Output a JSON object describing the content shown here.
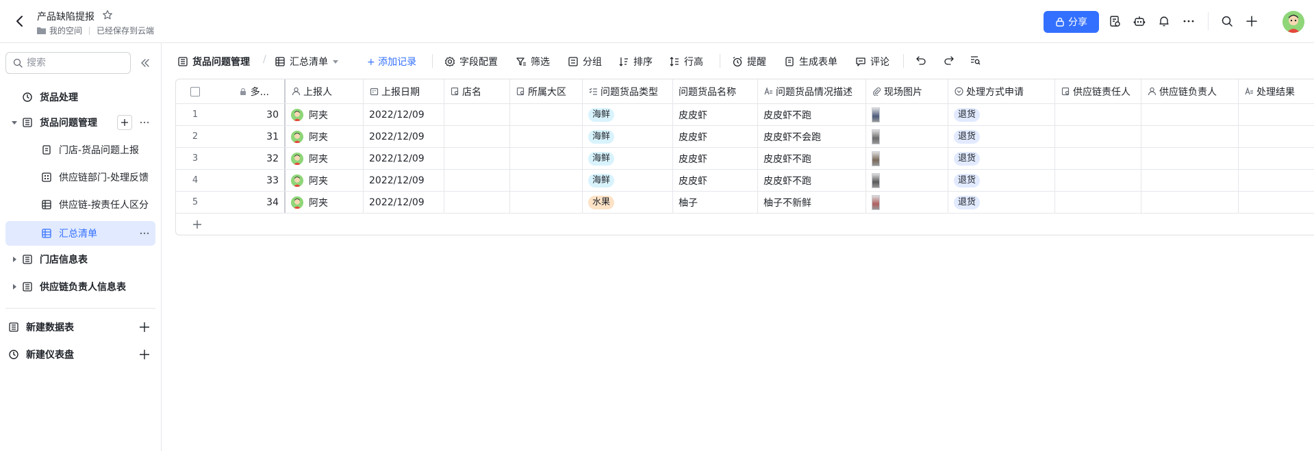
{
  "header": {
    "doc_title": "产品缺陷提报",
    "breadcrumb_space": "我的空间",
    "save_status": "已经保存到云端",
    "share_label": "分享"
  },
  "sidebar": {
    "search_placeholder": "搜索",
    "items": [
      {
        "label": "货品处理"
      },
      {
        "label": "货品问题管理"
      },
      {
        "label": "门店-货品问题上报"
      },
      {
        "label": "供应链部门-处理反馈"
      },
      {
        "label": "供应链-按责任人区分"
      },
      {
        "label": "汇总清单"
      },
      {
        "label": "门店信息表"
      },
      {
        "label": "供应链负责人信息表"
      }
    ],
    "new_table": "新建数据表",
    "new_dashboard": "新建仪表盘"
  },
  "toolbar": {
    "table_name": "货品问题管理",
    "view_name": "汇总清单",
    "add_record": "+ 添加记录",
    "field_config": "字段配置",
    "filter": "筛选",
    "group": "分组",
    "sort": "排序",
    "row_height": "行高",
    "reminder": "提醒",
    "form": "生成表单",
    "comment": "评论"
  },
  "table": {
    "columns": [
      "多...",
      "上报人",
      "上报日期",
      "店名",
      "所属大区",
      "问题货品类型",
      "问题货品名称",
      "问题货品情况描述",
      "现场图片",
      "处理方式申请",
      "供应链责任人",
      "供应链负责人",
      "处理结果"
    ],
    "rows": [
      {
        "idx": "1",
        "no": "30",
        "reporter": "阿夹",
        "date": "2022/12/09",
        "type": "海鲜",
        "name": "皮皮虾",
        "desc": "皮皮虾不跑",
        "action": "退货"
      },
      {
        "idx": "2",
        "no": "31",
        "reporter": "阿夹",
        "date": "2022/12/09",
        "type": "海鲜",
        "name": "皮皮虾",
        "desc": "皮皮虾不会跑",
        "action": "退货"
      },
      {
        "idx": "3",
        "no": "32",
        "reporter": "阿夹",
        "date": "2022/12/09",
        "type": "海鲜",
        "name": "皮皮虾",
        "desc": "皮皮虾不跑",
        "action": "退货"
      },
      {
        "idx": "4",
        "no": "33",
        "reporter": "阿夹",
        "date": "2022/12/09",
        "type": "海鲜",
        "name": "皮皮虾",
        "desc": "皮皮虾不跑",
        "action": "退货"
      },
      {
        "idx": "5",
        "no": "34",
        "reporter": "阿夹",
        "date": "2022/12/09",
        "type": "水果",
        "name": "柚子",
        "desc": "柚子不新鲜",
        "action": "退货"
      }
    ]
  },
  "colors": {
    "accent": "#3370ff",
    "tag_seafood": "#d9f3fd",
    "tag_fruit": "#fde2c6",
    "tag_return": "#e1eaff"
  }
}
